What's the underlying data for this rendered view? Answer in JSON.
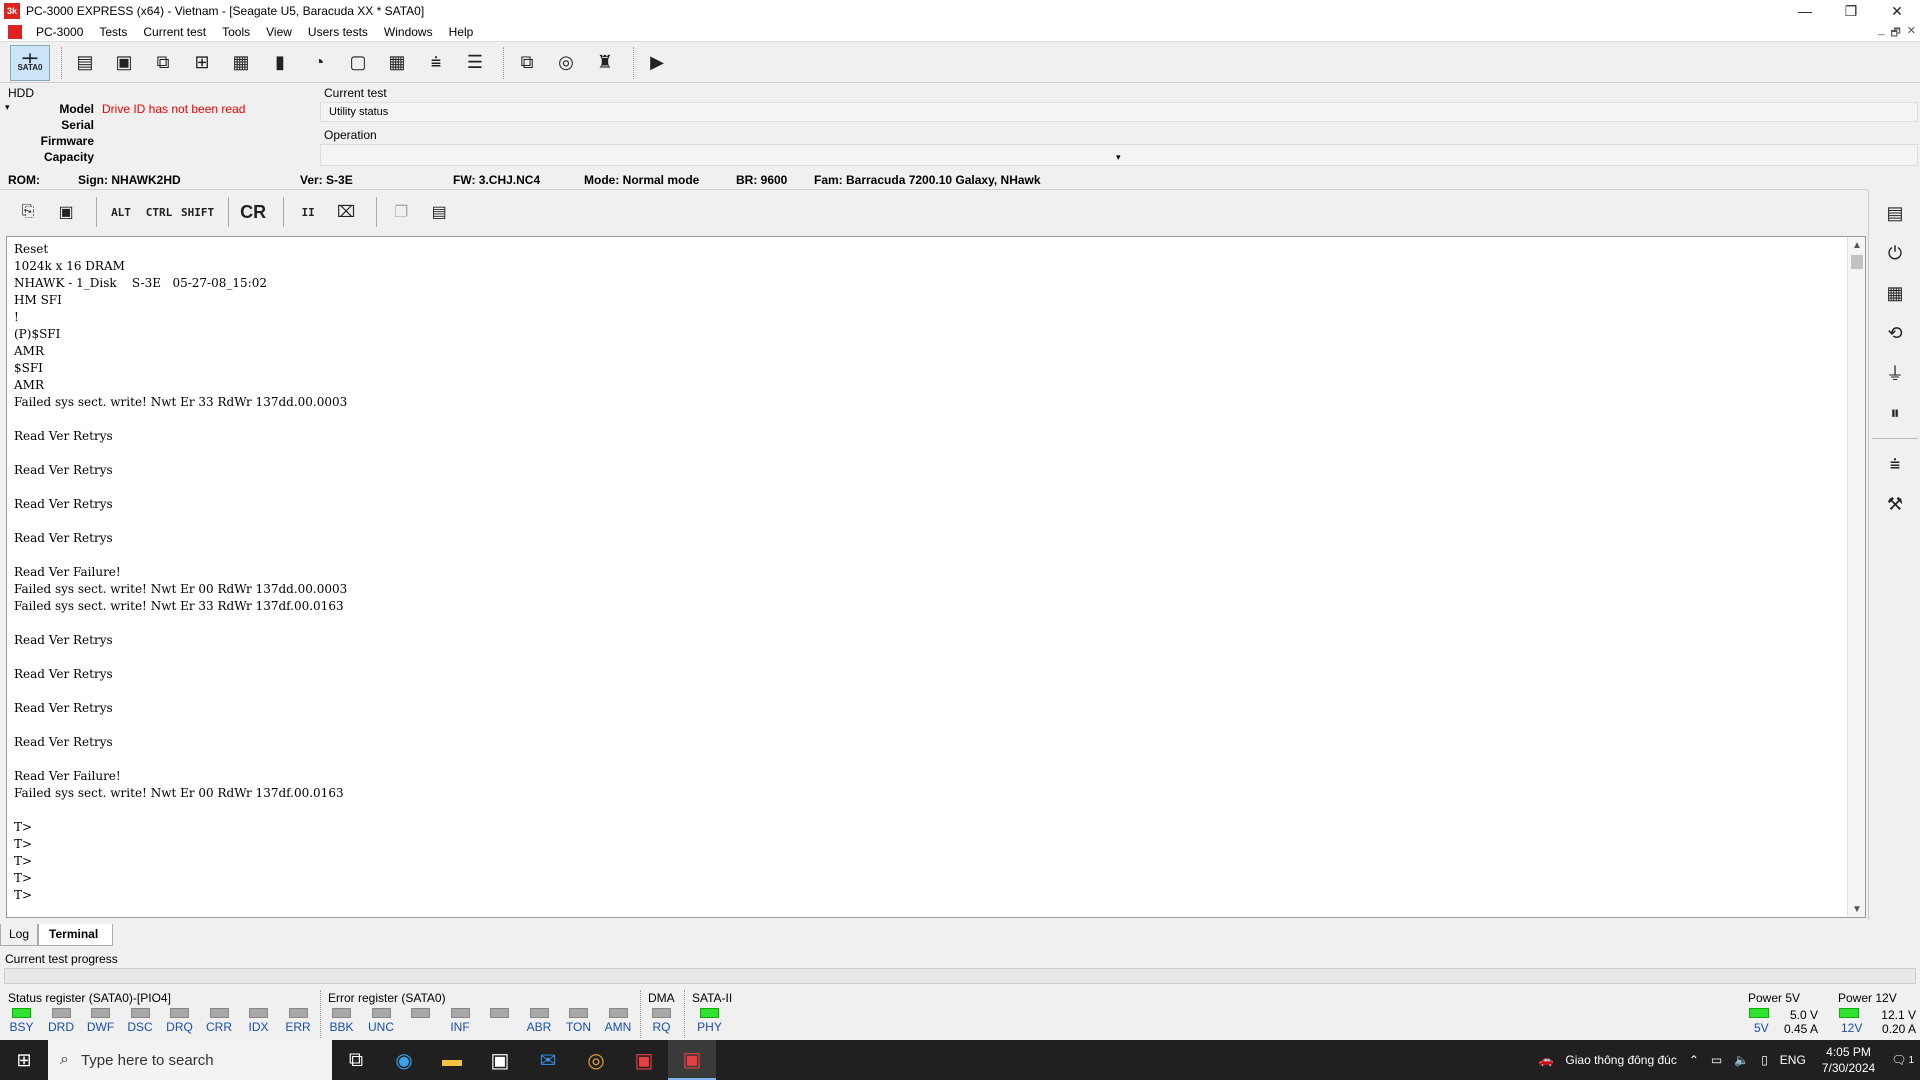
{
  "window": {
    "title": "PC-3000 EXPRESS (x64) - Vietnam - [Seagate U5, Baracuda XX * SATA0]",
    "app_icon_text": "3k",
    "controls": [
      "—",
      "❐",
      "✕"
    ]
  },
  "menu": [
    "PC-3000",
    "Tests",
    "Current test",
    "Tools",
    "View",
    "Users tests",
    "Windows",
    "Help"
  ],
  "mdi_controls": [
    "_",
    "🗗",
    "✕"
  ],
  "toolbar": {
    "sata_label": "SATA0"
  },
  "hdd": {
    "label": "HDD",
    "fields": [
      {
        "key": "Model",
        "value": "Drive ID has not been read"
      },
      {
        "key": "Serial",
        "value": ""
      },
      {
        "key": "Firmware",
        "value": ""
      },
      {
        "key": "Capacity",
        "value": ""
      }
    ]
  },
  "current_test": {
    "label": "Current test",
    "utility_status": "Utility status",
    "operation_label": "Operation"
  },
  "infobar": {
    "rom": "ROM:",
    "sign": "Sign: NHAWK2HD",
    "ver": "Ver: S-3E",
    "fw": "FW: 3.CHJ.NC4",
    "mode": "Mode: Normal mode",
    "br": "BR: 9600",
    "fam": "Fam: Barracuda 7200.10 Galaxy, NHawk"
  },
  "terminal_toolbar": {
    "alt": "ALT",
    "ctrl": "CTRL",
    "shift": "SHIFT",
    "cr": "CR",
    "pause": "II"
  },
  "terminal": {
    "lines": [
      "Reset",
      "1024k x 16 DRAM",
      "NHAWK - 1_Disk    S-3E   05-27-08_15:02",
      "HM SFI",
      "!",
      "(P)$SFI",
      "AMR",
      "$SFI",
      "AMR",
      "Failed sys sect. write! Nwt Er 33 RdWr 137dd.00.0003",
      "",
      "Read Ver Retrys",
      "",
      "Read Ver Retrys",
      "",
      "Read Ver Retrys",
      "",
      "Read Ver Retrys",
      "",
      "Read Ver Failure!",
      "Failed sys sect. write! Nwt Er 00 RdWr 137dd.00.0003",
      "Failed sys sect. write! Nwt Er 33 RdWr 137df.00.0163",
      "",
      "Read Ver Retrys",
      "",
      "Read Ver Retrys",
      "",
      "Read Ver Retrys",
      "",
      "Read Ver Retrys",
      "",
      "Read Ver Failure!",
      "Failed sys sect. write! Nwt Er 00 RdWr 137df.00.0163",
      "",
      "T>",
      "T>",
      "T>",
      "T>",
      "T>"
    ]
  },
  "tabs": [
    {
      "label": "Log",
      "active": false
    },
    {
      "label": "Terminal",
      "active": true
    }
  ],
  "progress": {
    "label": "Current test progress",
    "value": 0
  },
  "status_register": {
    "title": "Status register (SATA0)-[PIO4]",
    "leds": [
      {
        "label": "BSY",
        "on": true
      },
      {
        "label": "DRD",
        "on": false
      },
      {
        "label": "DWF",
        "on": false
      },
      {
        "label": "DSC",
        "on": false
      },
      {
        "label": "DRQ",
        "on": false
      },
      {
        "label": "CRR",
        "on": false
      },
      {
        "label": "IDX",
        "on": false
      },
      {
        "label": "ERR",
        "on": false
      }
    ]
  },
  "error_register": {
    "title": "Error register (SATA0)",
    "leds": [
      {
        "label": "BBK",
        "on": false
      },
      {
        "label": "UNC",
        "on": false
      },
      {
        "label": "",
        "on": false
      },
      {
        "label": "INF",
        "on": false
      },
      {
        "label": "",
        "on": false
      },
      {
        "label": "ABR",
        "on": false
      },
      {
        "label": "TON",
        "on": false
      },
      {
        "label": "AMN",
        "on": false
      }
    ]
  },
  "dma": {
    "title": "DMA",
    "label": "RQ",
    "on": false
  },
  "sata2": {
    "title": "SATA-II",
    "label": "PHY",
    "on": true
  },
  "power5": {
    "title": "Power 5V",
    "label": "5V",
    "voltage": "5.0 V",
    "current": "0.45 A"
  },
  "power12": {
    "title": "Power 12V",
    "label": "12V",
    "voltage": "12.1 V",
    "current": "0.20 A"
  },
  "taskbar": {
    "search_placeholder": "Type here to search",
    "weather": "Giao thông đông đúc",
    "lang": "ENG",
    "time": "4:05 PM",
    "date": "7/30/2024",
    "notification_count": "1"
  },
  "colors": {
    "led_on": "#2ee22e",
    "led_off": "#a8a8a8",
    "error_text": "#e00000",
    "led_label": "#1a4fa8"
  }
}
